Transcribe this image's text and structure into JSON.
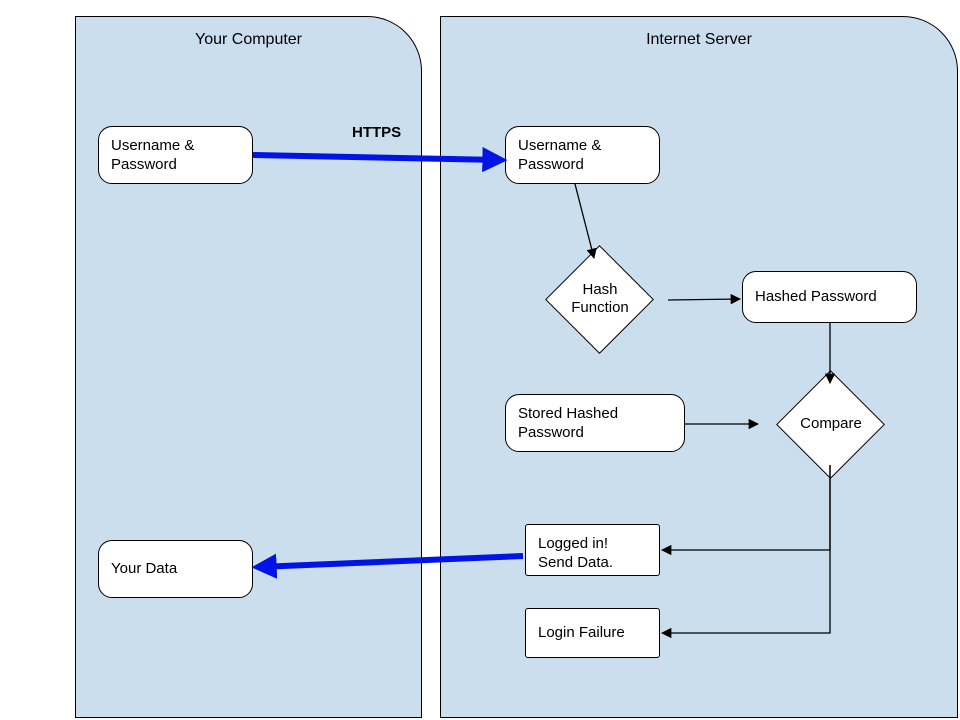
{
  "panels": {
    "client": {
      "title": "Your Computer"
    },
    "server": {
      "title": "Internet Server"
    }
  },
  "nodes": {
    "client_creds": "Username & Password",
    "server_creds": "Username & Password",
    "hash_fn": "Hash Function",
    "hashed_pw": "Hashed Password",
    "stored_hashed_pw": "Stored Hashed Password",
    "compare": "Compare",
    "logged_in": "Logged in! Send Data.",
    "login_failure": "Login Failure",
    "your_data": "Your Data"
  },
  "labels": {
    "https": "HTTPS"
  },
  "flow": {
    "description": "Client sends Username & Password over HTTPS to server. Server runs Hash Function on the password to produce a Hashed Password. That is compared against the Stored Hashed Password. If they match: Logged in! Send Data back to client (Your Data). Otherwise: Login Failure.",
    "edges": [
      {
        "from": "client_creds",
        "to": "server_creds",
        "label": "HTTPS",
        "style": "thick-blue"
      },
      {
        "from": "server_creds",
        "to": "hash_fn"
      },
      {
        "from": "hash_fn",
        "to": "hashed_pw"
      },
      {
        "from": "hashed_pw",
        "to": "compare"
      },
      {
        "from": "stored_hashed_pw",
        "to": "compare"
      },
      {
        "from": "compare",
        "to": "logged_in"
      },
      {
        "from": "compare",
        "to": "login_failure"
      },
      {
        "from": "logged_in",
        "to": "your_data",
        "style": "thick-blue"
      }
    ]
  }
}
